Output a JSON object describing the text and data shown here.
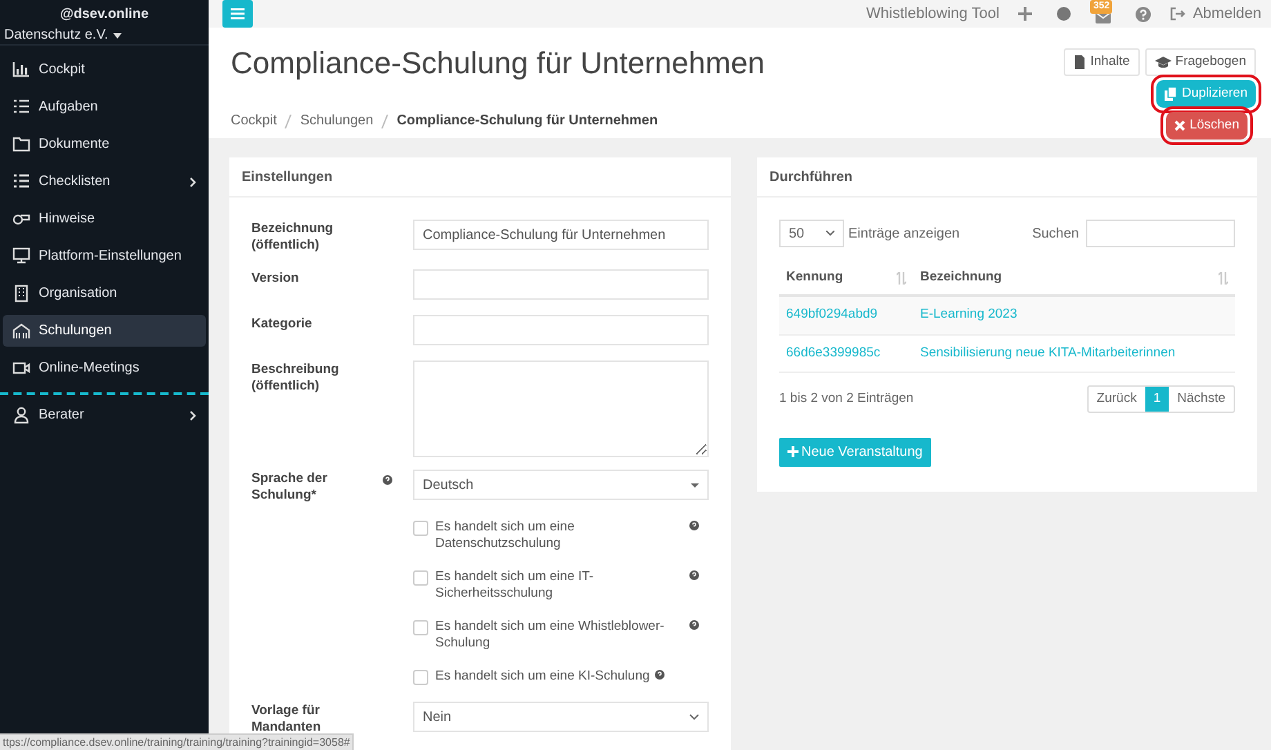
{
  "sidebar": {
    "account": "@dsev.online",
    "org": "Datenschutz e.V.",
    "items": [
      {
        "label": "Cockpit",
        "selected": false,
        "expandable": false
      },
      {
        "label": "Aufgaben",
        "selected": false,
        "expandable": false
      },
      {
        "label": "Dokumente",
        "selected": false,
        "expandable": false
      },
      {
        "label": "Checklisten",
        "selected": false,
        "expandable": true
      },
      {
        "label": "Hinweise",
        "selected": false,
        "expandable": false
      },
      {
        "label": "Plattform-Einstellungen",
        "selected": false,
        "expandable": false
      },
      {
        "label": "Organisation",
        "selected": false,
        "expandable": false
      },
      {
        "label": "Schulungen",
        "selected": true,
        "expandable": false
      },
      {
        "label": "Online-Meetings",
        "selected": false,
        "expandable": false
      }
    ],
    "bottom_items": [
      {
        "label": "Berater",
        "selected": false,
        "expandable": true
      }
    ]
  },
  "topbar": {
    "tool": "Whistleblowing Tool",
    "mail_badge": "352",
    "logout": "Abmelden"
  },
  "page": {
    "title": "Compliance-Schulung für Unternehmen",
    "actions": [
      {
        "label": "Inhalte",
        "kind": "plain",
        "highlighted": false
      },
      {
        "label": "Fragebogen",
        "kind": "plain",
        "highlighted": false
      },
      {
        "label": "Duplizieren",
        "kind": "primary",
        "highlighted": true
      },
      {
        "label": "Löschen",
        "kind": "danger",
        "highlighted": true
      }
    ],
    "breadcrumb": [
      "Cockpit",
      "Schulungen",
      "Compliance-Schulung für Unternehmen"
    ]
  },
  "settings": {
    "title": "Einstellungen",
    "fields": [
      {
        "label": "Bezeichnung (öffentlich)",
        "kind": "text",
        "value": "Compliance-Schulung für Unternehmen"
      },
      {
        "label": "Version",
        "kind": "text"
      },
      {
        "label": "Kategorie",
        "kind": "text"
      },
      {
        "label": "Beschreibung (öffentlich)",
        "kind": "textarea"
      },
      {
        "label": "Sprache der Schulung*",
        "kind": "select",
        "value": "Deutsch",
        "help": true
      }
    ],
    "checkboxes": [
      {
        "label": "Es handelt sich um eine Datenschutzschulung",
        "checked": false
      },
      {
        "label": "Es handelt sich um eine IT-Sicherheitsschulung",
        "checked": false
      },
      {
        "label": "Es handelt sich um eine Whistleblower-Schulung",
        "checked": false
      },
      {
        "label": "Es handelt sich um eine KI-Schulung",
        "checked": false
      }
    ],
    "template": {
      "label": "Vorlage für Mandanten",
      "value": "Nein"
    }
  },
  "runs": {
    "title": "Durchführen",
    "page_size": "50",
    "page_size_label": "Einträge anzeigen",
    "search_label": "Suchen",
    "columns": [
      "Kennung",
      "Bezeichnung"
    ],
    "rows": [
      [
        "649bf0294abd9",
        "E-Learning 2023"
      ],
      [
        "66d6e3399985c",
        "Sensibilisierung neue KITA-Mitarbeiterinnen"
      ]
    ],
    "info": "1 bis 2 von 2 Einträgen",
    "pagination": [
      {
        "label": "Zurück",
        "selected": false
      },
      {
        "label": "1",
        "selected": true
      },
      {
        "label": "Nächste",
        "selected": false
      }
    ],
    "new_button": "Neue Veranstaltung"
  },
  "status_bar": {
    "url": "ttps://compliance.dsev.online/training/training/training?trainingid=3058#"
  }
}
